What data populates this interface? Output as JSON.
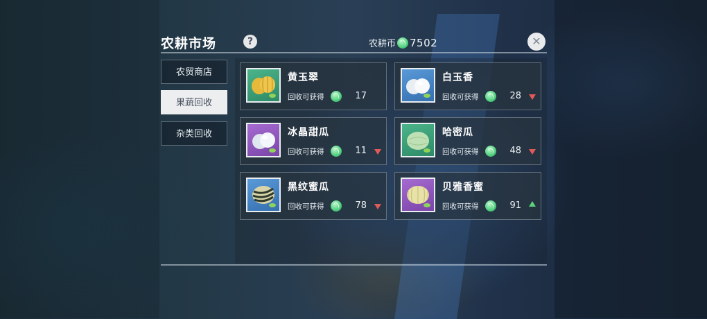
{
  "header": {
    "title": "农耕市场",
    "help_label": "?",
    "currency_label": "农耕币",
    "currency_value": "7502",
    "close_label": "✕"
  },
  "sidebar": {
    "tabs": [
      {
        "label": "农贸商店",
        "active": false
      },
      {
        "label": "果蔬回收",
        "active": true
      },
      {
        "label": "杂类回收",
        "active": false
      }
    ]
  },
  "items": [
    {
      "name": "黄玉翠",
      "reward_label": "回收可获得",
      "value": "17",
      "trend": "none",
      "icon": "yellow-melon-icon",
      "thumb_color": "green"
    },
    {
      "name": "白玉香",
      "reward_label": "回收可获得",
      "value": "28",
      "trend": "down",
      "icon": "white-melon-icon",
      "thumb_color": "blue"
    },
    {
      "name": "冰晶甜瓜",
      "reward_label": "回收可获得",
      "value": "11",
      "trend": "down",
      "icon": "ice-melon-icon",
      "thumb_color": "purple"
    },
    {
      "name": "哈密瓜",
      "reward_label": "回收可获得",
      "value": "48",
      "trend": "down",
      "icon": "hami-melon-icon",
      "thumb_color": "green"
    },
    {
      "name": "黑纹蜜瓜",
      "reward_label": "回收可获得",
      "value": "78",
      "trend": "down",
      "icon": "striped-melon-icon",
      "thumb_color": "blue"
    },
    {
      "name": "贝雅香蜜",
      "reward_label": "回收可获得",
      "value": "91",
      "trend": "up",
      "icon": "cream-melon-icon",
      "thumb_color": "purple"
    }
  ],
  "colors": {
    "accent_coin": "#4fcf7e",
    "trend_down": "#e05a5a",
    "trend_up": "#5bd37a"
  }
}
